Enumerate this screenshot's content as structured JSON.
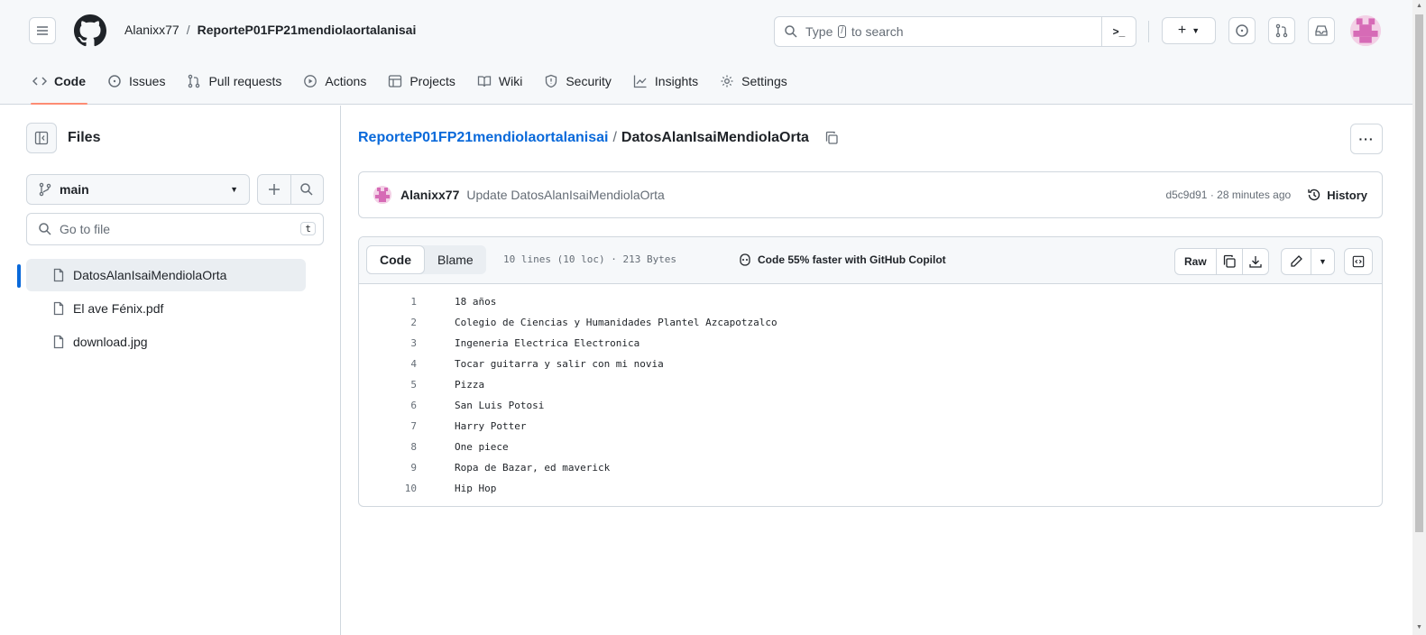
{
  "header": {
    "owner": "Alanixx77",
    "separator": "/",
    "repo": "ReporteP01FP21mendiolaortalanisai",
    "search": {
      "prefix": "Type",
      "key": "/",
      "suffix": "to search"
    },
    "command_label": ">_",
    "plus_label": "+"
  },
  "tabs": [
    {
      "label": "Code",
      "icon": "code-icon",
      "active": true
    },
    {
      "label": "Issues",
      "icon": "issue-icon"
    },
    {
      "label": "Pull requests",
      "icon": "pull-request-icon"
    },
    {
      "label": "Actions",
      "icon": "play-icon"
    },
    {
      "label": "Projects",
      "icon": "table-icon"
    },
    {
      "label": "Wiki",
      "icon": "book-icon"
    },
    {
      "label": "Security",
      "icon": "shield-icon"
    },
    {
      "label": "Insights",
      "icon": "graph-icon"
    },
    {
      "label": "Settings",
      "icon": "gear-icon"
    }
  ],
  "sidebar": {
    "title": "Files",
    "branch": "main",
    "goto_placeholder": "Go to file",
    "goto_shortcut": "t",
    "files": [
      {
        "name": "DatosAlanIsaiMendiolaOrta",
        "active": true
      },
      {
        "name": "El ave Fénix.pdf"
      },
      {
        "name": "download.jpg"
      }
    ]
  },
  "main": {
    "path_repo": "ReporteP01FP21mendiolaortalanisai",
    "path_sep": "/",
    "path_file": "DatosAlanIsaiMendiolaOrta",
    "more_label": "···",
    "commit": {
      "author": "Alanixx77",
      "message": "Update DatosAlanIsaiMendiolaOrta",
      "sha_time": "d5c9d91 · 28 minutes ago",
      "history": "History"
    },
    "file_header": {
      "code_tab": "Code",
      "blame_tab": "Blame",
      "lines_info": "10 lines (10 loc) · 213 Bytes",
      "copilot": "Code 55% faster with GitHub Copilot",
      "raw": "Raw"
    },
    "code_lines": [
      {
        "n": "1",
        "text": "18 años"
      },
      {
        "n": "2",
        "text": "Colegio de Ciencias y Humanidades Plantel Azcapotzalco"
      },
      {
        "n": "3",
        "text": "Ingeneria Electrica Electronica"
      },
      {
        "n": "4",
        "text": "Tocar guitarra y salir con mi novia"
      },
      {
        "n": "5",
        "text": "Pizza"
      },
      {
        "n": "6",
        "text": "San Luis Potosi"
      },
      {
        "n": "7",
        "text": "Harry Potter"
      },
      {
        "n": "8",
        "text": "One piece"
      },
      {
        "n": "9",
        "text": "Ropa de Bazar, ed maverick"
      },
      {
        "n": "10",
        "text": "Hip Hop"
      }
    ]
  },
  "colors": {
    "accent": "#0969da",
    "tab_underline": "#fd8c73",
    "border": "#d0d7de",
    "muted": "#656d76"
  }
}
